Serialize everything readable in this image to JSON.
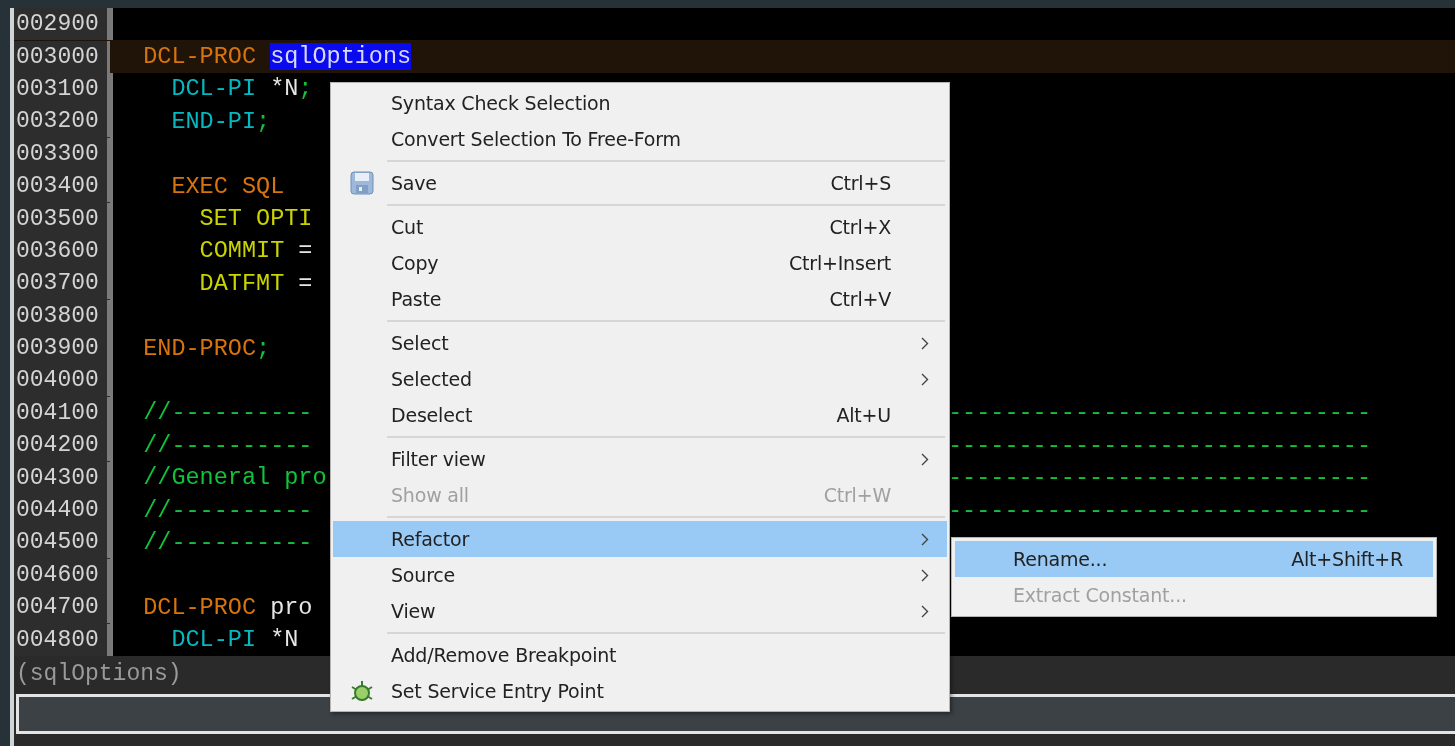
{
  "editor": {
    "lines": [
      {
        "number": "002900",
        "current": false
      },
      {
        "number": "003000",
        "current": true,
        "tokens": [
          {
            "kind": "keyword",
            "text": "  DCL-PROC "
          },
          {
            "kind": "selection",
            "text": "sqlOptions"
          }
        ]
      },
      {
        "number": "003100",
        "current": false,
        "tokens": [
          {
            "kind": "interface",
            "text": "    DCL-PI "
          },
          {
            "kind": "plain",
            "text": "*N"
          },
          {
            "kind": "comment",
            "text": ";"
          }
        ]
      },
      {
        "number": "003200",
        "current": false,
        "tokens": [
          {
            "kind": "interface",
            "text": "    END-PI"
          },
          {
            "kind": "comment",
            "text": ";"
          }
        ]
      },
      {
        "number": "003300",
        "current": false
      },
      {
        "number": "003400",
        "current": false,
        "tokens": [
          {
            "kind": "keyword",
            "text": "    EXEC SQL"
          }
        ]
      },
      {
        "number": "003500",
        "current": false,
        "tokens": [
          {
            "kind": "sql",
            "text": "      SET OPTI"
          }
        ]
      },
      {
        "number": "003600",
        "current": false,
        "tokens": [
          {
            "kind": "sql",
            "text": "      COMMIT "
          },
          {
            "kind": "plain",
            "text": "="
          }
        ]
      },
      {
        "number": "003700",
        "current": false,
        "tokens": [
          {
            "kind": "sql",
            "text": "      DATFMT "
          },
          {
            "kind": "plain",
            "text": "="
          }
        ]
      },
      {
        "number": "003800",
        "current": false
      },
      {
        "number": "003900",
        "current": false,
        "tokens": [
          {
            "kind": "keyword",
            "text": "  END-PROC"
          },
          {
            "kind": "comment",
            "text": ";"
          }
        ]
      },
      {
        "number": "004000",
        "current": false
      },
      {
        "number": "004100",
        "current": false,
        "tokens": [
          {
            "kind": "comment",
            "text": "  //----------"
          }
        ],
        "tail": "------------------------------"
      },
      {
        "number": "004200",
        "current": false,
        "tokens": [
          {
            "kind": "comment",
            "text": "  //----------"
          }
        ],
        "tail": "------------------------------"
      },
      {
        "number": "004300",
        "current": false,
        "tokens": [
          {
            "kind": "comment",
            "text": "  //General pro"
          }
        ],
        "tail": "------------------------------"
      },
      {
        "number": "004400",
        "current": false,
        "tokens": [
          {
            "kind": "comment",
            "text": "  //----------"
          }
        ],
        "tail": "------------------------------"
      },
      {
        "number": "004500",
        "current": false,
        "tokens": [
          {
            "kind": "comment",
            "text": "  //----------"
          }
        ]
      },
      {
        "number": "004600",
        "current": false
      },
      {
        "number": "004700",
        "current": false,
        "tokens": [
          {
            "kind": "keyword",
            "text": "  DCL-PROC "
          },
          {
            "kind": "plain",
            "text": "pro"
          }
        ]
      },
      {
        "number": "004800",
        "current": false,
        "tokens": [
          {
            "kind": "interface",
            "text": "    DCL-PI "
          },
          {
            "kind": "plain",
            "text": "*N"
          }
        ]
      }
    ]
  },
  "status": {
    "text": "(sqlOptions)"
  },
  "context_menu": {
    "items": [
      {
        "kind": "item",
        "label": "Syntax Check Selection",
        "submenu": false,
        "disabled": false,
        "selected": false
      },
      {
        "kind": "item",
        "label": "Convert Selection To Free-Form",
        "submenu": false,
        "disabled": false,
        "selected": false
      },
      {
        "kind": "separator"
      },
      {
        "kind": "save",
        "label": "Save",
        "shortcut": "Ctrl+S",
        "submenu": false,
        "disabled": false,
        "selected": false
      },
      {
        "kind": "separator"
      },
      {
        "kind": "item",
        "label": "Cut",
        "shortcut": "Ctrl+X",
        "submenu": false,
        "disabled": false,
        "selected": false
      },
      {
        "kind": "item",
        "label": "Copy",
        "shortcut": "Ctrl+Insert",
        "submenu": false,
        "disabled": false,
        "selected": false
      },
      {
        "kind": "item",
        "label": "Paste",
        "shortcut": "Ctrl+V",
        "submenu": false,
        "disabled": false,
        "selected": false
      },
      {
        "kind": "separator"
      },
      {
        "kind": "item",
        "label": "Select",
        "submenu": true,
        "disabled": false,
        "selected": false
      },
      {
        "kind": "item",
        "label": "Selected",
        "submenu": true,
        "disabled": false,
        "selected": false
      },
      {
        "kind": "item",
        "label": "Deselect",
        "shortcut": "Alt+U",
        "submenu": false,
        "disabled": false,
        "selected": false
      },
      {
        "kind": "separator"
      },
      {
        "kind": "item",
        "label": "Filter view",
        "submenu": true,
        "disabled": false,
        "selected": false
      },
      {
        "kind": "item",
        "label": "Show all",
        "shortcut": "Ctrl+W",
        "submenu": false,
        "disabled": true,
        "selected": false
      },
      {
        "kind": "separator"
      },
      {
        "kind": "item",
        "label": "Refactor",
        "submenu": true,
        "disabled": false,
        "selected": true,
        "children": [
          {
            "label": "Rename...",
            "shortcut": "Alt+Shift+R",
            "disabled": false,
            "selected": true
          },
          {
            "label": "Extract Constant...",
            "disabled": true,
            "selected": false
          }
        ]
      },
      {
        "kind": "item",
        "label": "Source",
        "submenu": true,
        "disabled": false,
        "selected": false
      },
      {
        "kind": "item",
        "label": "View",
        "submenu": true,
        "disabled": false,
        "selected": false
      },
      {
        "kind": "separator"
      },
      {
        "kind": "item",
        "label": "Add/Remove Breakpoint",
        "submenu": false,
        "disabled": false,
        "selected": false
      },
      {
        "kind": "service",
        "label": "Set Service Entry Point",
        "submenu": false,
        "disabled": false,
        "selected": false
      }
    ]
  }
}
